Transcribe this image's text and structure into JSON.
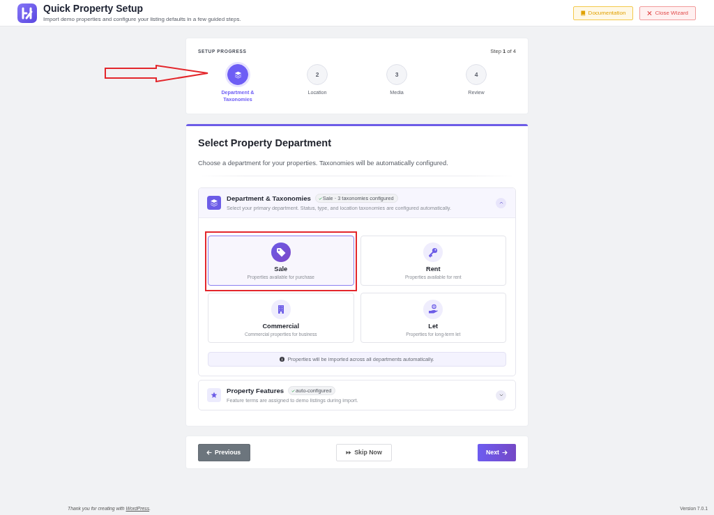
{
  "header": {
    "title": "Quick Property Setup",
    "subtitle": "Import demo properties and configure your listing defaults in a few guided steps.",
    "buttons": [
      {
        "label": "Documentation",
        "kind": "documentation"
      },
      {
        "label": "Close Wizard",
        "kind": "close"
      }
    ]
  },
  "progress": {
    "heading": "SETUP PROGRESS",
    "step_text": "Step **1** of 4",
    "steps": [
      {
        "label": "Department & Taxonomies",
        "selected": true,
        "pointed_at": true
      },
      {
        "number": "2",
        "label": "Location",
        "selected": false,
        "pointed_at": false
      },
      {
        "number": "3",
        "label": "Media",
        "selected": false,
        "pointed_at": false
      },
      {
        "number": "4",
        "label": "Review",
        "selected": false,
        "pointed_at": false
      }
    ]
  },
  "main": {
    "title": "Select Property Department",
    "description": "Choose a department for your properties. Taxonomies will be automatically configured.",
    "sections": [
      {
        "kind": "departments",
        "title": "Department & Taxonomies",
        "badge": "Sale · 3 taxonomies configured",
        "description": "Select your primary department. Status, type, and location taxonomies are configured automatically.",
        "expanded": true,
        "options": [
          {
            "kind": "tag",
            "title": "Sale",
            "description": "Properties available for purchase",
            "selected": true,
            "highlighted": true
          },
          {
            "kind": "key",
            "title": "Rent",
            "description": "Properties available for rent",
            "selected": false,
            "highlighted": false
          },
          {
            "kind": "building",
            "title": "Commercial",
            "description": "Commercial properties for business",
            "selected": false,
            "highlighted": false
          },
          {
            "kind": "hand",
            "title": "Let",
            "description": "Properties for long-term let",
            "selected": false,
            "highlighted": false
          }
        ],
        "note": "Properties will be imported across all departments automatically."
      },
      {
        "kind": "features",
        "title": "Property Features",
        "badge": "auto-configured",
        "description": "Feature terms are assigned to demo listings during import.",
        "expanded": false
      }
    ]
  },
  "nav": {
    "buttons": [
      {
        "label": "Previous",
        "kind": "previous"
      },
      {
        "label": "Skip Now",
        "kind": "skip"
      },
      {
        "label": "Next",
        "kind": "next"
      }
    ]
  },
  "footer": {
    "text": "Thank you for creating with ",
    "link": "WordPress",
    "end": ".",
    "version": "Version 7.0.1"
  }
}
